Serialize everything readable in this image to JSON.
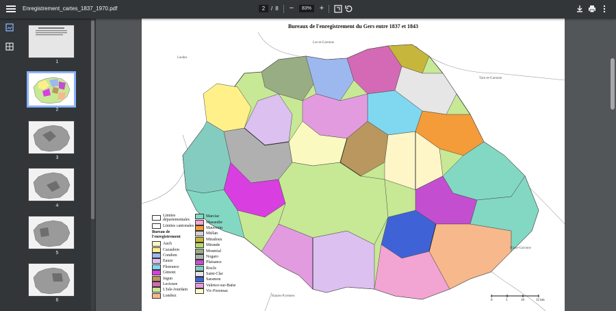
{
  "toolbar": {
    "filename": "Enregistrement_cartes_1837_1970.pdf",
    "current_page": "2",
    "page_separator": "/",
    "total_pages": "8",
    "zoom": "83%",
    "zoom_out": "−",
    "zoom_in": "+"
  },
  "sidebar": {
    "thumbnail_view_icon": "image-icon",
    "outline_icon": "outline-icon"
  },
  "thumbnails": [
    {
      "label": "1"
    },
    {
      "label": "2"
    },
    {
      "label": "3"
    },
    {
      "label": "4"
    },
    {
      "label": "5"
    },
    {
      "label": "6"
    }
  ],
  "map": {
    "title": "Bureaux de l'enregistrement du Gers entre 1837 et 1843",
    "neighbors": {
      "landes": "Landes",
      "lot_et_garonne": "Lot-et-Garonne",
      "tarn_et_garonne": "Tarn-et-Garonne",
      "haute_garonne": "Haute-Garonne",
      "hautes_pyrenees": "Hautes-Pyrénées"
    },
    "legend": {
      "limites_dep": "Limites départementales",
      "limites_cant": "Limites cantonales",
      "heading": "Bureau de l'enregistrement",
      "col1": [
        {
          "name": "Auch",
          "color": "#fff6c8"
        },
        {
          "name": "Cazaubon",
          "color": "#fff08a"
        },
        {
          "name": "Condom",
          "color": "#9db8ef"
        },
        {
          "name": "Eauze",
          "color": "#dcc0f0"
        },
        {
          "name": "Fleurance",
          "color": "#7fd8f0"
        },
        {
          "name": "Gimont",
          "color": "#d93fe0"
        },
        {
          "name": "Jegun",
          "color": "#b9975e"
        },
        {
          "name": "Lectoure",
          "color": "#d46ab5"
        },
        {
          "name": "L'Isle-Jourdain",
          "color": "#c7e895"
        },
        {
          "name": "Lombez",
          "color": "#f7b88c"
        }
      ],
      "col2": [
        {
          "name": "Marciac",
          "color": "#83d8c3"
        },
        {
          "name": "Masseube",
          "color": "#f2a4d2"
        },
        {
          "name": "Mauvezin",
          "color": "#f49b3a"
        },
        {
          "name": "Miélan",
          "color": "#d0d0d0"
        },
        {
          "name": "Miradoux",
          "color": "#c7b63c"
        },
        {
          "name": "Mirande",
          "color": "#b7d96c"
        },
        {
          "name": "Montréal",
          "color": "#99ad84"
        },
        {
          "name": "Nogaro",
          "color": "#b0b0b0"
        },
        {
          "name": "Plaisance",
          "color": "#c34fd0"
        },
        {
          "name": "Riscle",
          "color": "#84ccc0"
        },
        {
          "name": "Saint-Clar",
          "color": "#e6e6e6"
        },
        {
          "name": "Saramon",
          "color": "#3f63d6"
        },
        {
          "name": "Valence-sur-Baïse",
          "color": "#e39be0"
        },
        {
          "name": "Vic-Fezensac",
          "color": "#fafac0"
        }
      ]
    },
    "scale": {
      "ticks": [
        "0",
        "5",
        "10",
        "15 km"
      ]
    }
  }
}
